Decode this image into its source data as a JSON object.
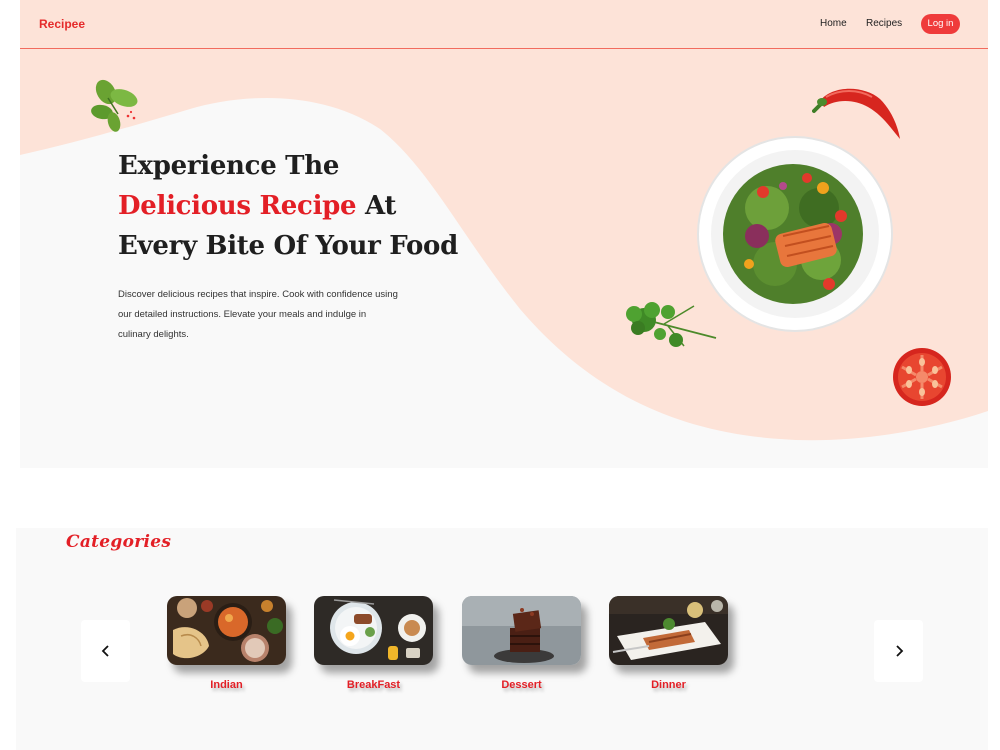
{
  "nav": {
    "brand": "Recipee",
    "links": [
      "Home",
      "Recipes"
    ],
    "login_label": "Log in"
  },
  "hero": {
    "title_line1": "Experience The",
    "title_accent": "Delicious Recipe",
    "title_after_accent": " At",
    "title_line3": "Every Bite Of Your Food",
    "description": "Discover delicious recipes that inspire. Cook with confidence using our detailed instructions. Elevate your meals and indulge in culinary delights."
  },
  "categories": {
    "title": "Categories",
    "items": [
      {
        "label": "Indian"
      },
      {
        "label": "BreakFast"
      },
      {
        "label": "Dessert"
      },
      {
        "label": "Dinner"
      }
    ]
  },
  "icons": {
    "prev": "chevron-left-icon",
    "next": "chevron-right-icon"
  },
  "colors": {
    "accent": "#e31f26",
    "nav_bg": "#fde3d8",
    "hero_blob": "#fde3d8",
    "button": "#ef3b3b"
  }
}
